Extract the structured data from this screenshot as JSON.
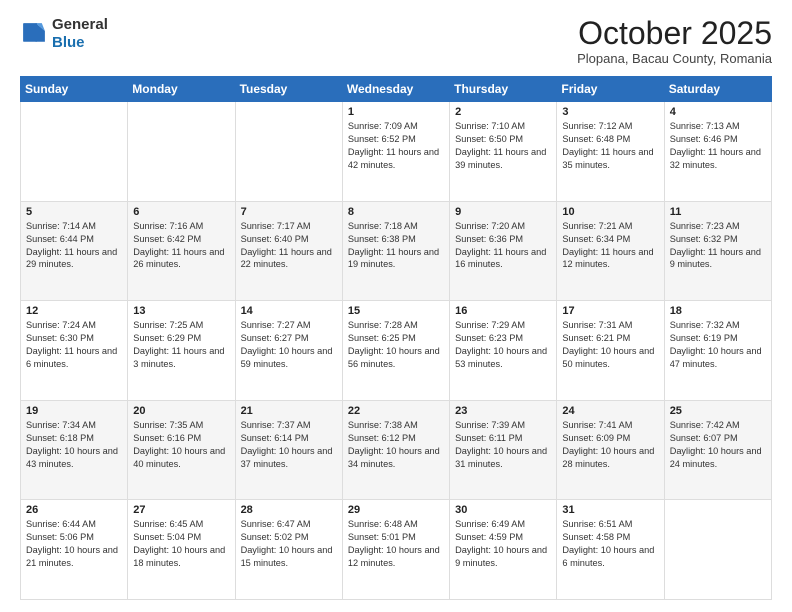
{
  "header": {
    "logo_line1": "General",
    "logo_line2": "Blue",
    "month": "October 2025",
    "location": "Plopana, Bacau County, Romania"
  },
  "days_of_week": [
    "Sunday",
    "Monday",
    "Tuesday",
    "Wednesday",
    "Thursday",
    "Friday",
    "Saturday"
  ],
  "weeks": [
    [
      {
        "day": "",
        "info": ""
      },
      {
        "day": "",
        "info": ""
      },
      {
        "day": "",
        "info": ""
      },
      {
        "day": "1",
        "info": "Sunrise: 7:09 AM\nSunset: 6:52 PM\nDaylight: 11 hours and 42 minutes."
      },
      {
        "day": "2",
        "info": "Sunrise: 7:10 AM\nSunset: 6:50 PM\nDaylight: 11 hours and 39 minutes."
      },
      {
        "day": "3",
        "info": "Sunrise: 7:12 AM\nSunset: 6:48 PM\nDaylight: 11 hours and 35 minutes."
      },
      {
        "day": "4",
        "info": "Sunrise: 7:13 AM\nSunset: 6:46 PM\nDaylight: 11 hours and 32 minutes."
      }
    ],
    [
      {
        "day": "5",
        "info": "Sunrise: 7:14 AM\nSunset: 6:44 PM\nDaylight: 11 hours and 29 minutes."
      },
      {
        "day": "6",
        "info": "Sunrise: 7:16 AM\nSunset: 6:42 PM\nDaylight: 11 hours and 26 minutes."
      },
      {
        "day": "7",
        "info": "Sunrise: 7:17 AM\nSunset: 6:40 PM\nDaylight: 11 hours and 22 minutes."
      },
      {
        "day": "8",
        "info": "Sunrise: 7:18 AM\nSunset: 6:38 PM\nDaylight: 11 hours and 19 minutes."
      },
      {
        "day": "9",
        "info": "Sunrise: 7:20 AM\nSunset: 6:36 PM\nDaylight: 11 hours and 16 minutes."
      },
      {
        "day": "10",
        "info": "Sunrise: 7:21 AM\nSunset: 6:34 PM\nDaylight: 11 hours and 12 minutes."
      },
      {
        "day": "11",
        "info": "Sunrise: 7:23 AM\nSunset: 6:32 PM\nDaylight: 11 hours and 9 minutes."
      }
    ],
    [
      {
        "day": "12",
        "info": "Sunrise: 7:24 AM\nSunset: 6:30 PM\nDaylight: 11 hours and 6 minutes."
      },
      {
        "day": "13",
        "info": "Sunrise: 7:25 AM\nSunset: 6:29 PM\nDaylight: 11 hours and 3 minutes."
      },
      {
        "day": "14",
        "info": "Sunrise: 7:27 AM\nSunset: 6:27 PM\nDaylight: 10 hours and 59 minutes."
      },
      {
        "day": "15",
        "info": "Sunrise: 7:28 AM\nSunset: 6:25 PM\nDaylight: 10 hours and 56 minutes."
      },
      {
        "day": "16",
        "info": "Sunrise: 7:29 AM\nSunset: 6:23 PM\nDaylight: 10 hours and 53 minutes."
      },
      {
        "day": "17",
        "info": "Sunrise: 7:31 AM\nSunset: 6:21 PM\nDaylight: 10 hours and 50 minutes."
      },
      {
        "day": "18",
        "info": "Sunrise: 7:32 AM\nSunset: 6:19 PM\nDaylight: 10 hours and 47 minutes."
      }
    ],
    [
      {
        "day": "19",
        "info": "Sunrise: 7:34 AM\nSunset: 6:18 PM\nDaylight: 10 hours and 43 minutes."
      },
      {
        "day": "20",
        "info": "Sunrise: 7:35 AM\nSunset: 6:16 PM\nDaylight: 10 hours and 40 minutes."
      },
      {
        "day": "21",
        "info": "Sunrise: 7:37 AM\nSunset: 6:14 PM\nDaylight: 10 hours and 37 minutes."
      },
      {
        "day": "22",
        "info": "Sunrise: 7:38 AM\nSunset: 6:12 PM\nDaylight: 10 hours and 34 minutes."
      },
      {
        "day": "23",
        "info": "Sunrise: 7:39 AM\nSunset: 6:11 PM\nDaylight: 10 hours and 31 minutes."
      },
      {
        "day": "24",
        "info": "Sunrise: 7:41 AM\nSunset: 6:09 PM\nDaylight: 10 hours and 28 minutes."
      },
      {
        "day": "25",
        "info": "Sunrise: 7:42 AM\nSunset: 6:07 PM\nDaylight: 10 hours and 24 minutes."
      }
    ],
    [
      {
        "day": "26",
        "info": "Sunrise: 6:44 AM\nSunset: 5:06 PM\nDaylight: 10 hours and 21 minutes."
      },
      {
        "day": "27",
        "info": "Sunrise: 6:45 AM\nSunset: 5:04 PM\nDaylight: 10 hours and 18 minutes."
      },
      {
        "day": "28",
        "info": "Sunrise: 6:47 AM\nSunset: 5:02 PM\nDaylight: 10 hours and 15 minutes."
      },
      {
        "day": "29",
        "info": "Sunrise: 6:48 AM\nSunset: 5:01 PM\nDaylight: 10 hours and 12 minutes."
      },
      {
        "day": "30",
        "info": "Sunrise: 6:49 AM\nSunset: 4:59 PM\nDaylight: 10 hours and 9 minutes."
      },
      {
        "day": "31",
        "info": "Sunrise: 6:51 AM\nSunset: 4:58 PM\nDaylight: 10 hours and 6 minutes."
      },
      {
        "day": "",
        "info": ""
      }
    ]
  ]
}
